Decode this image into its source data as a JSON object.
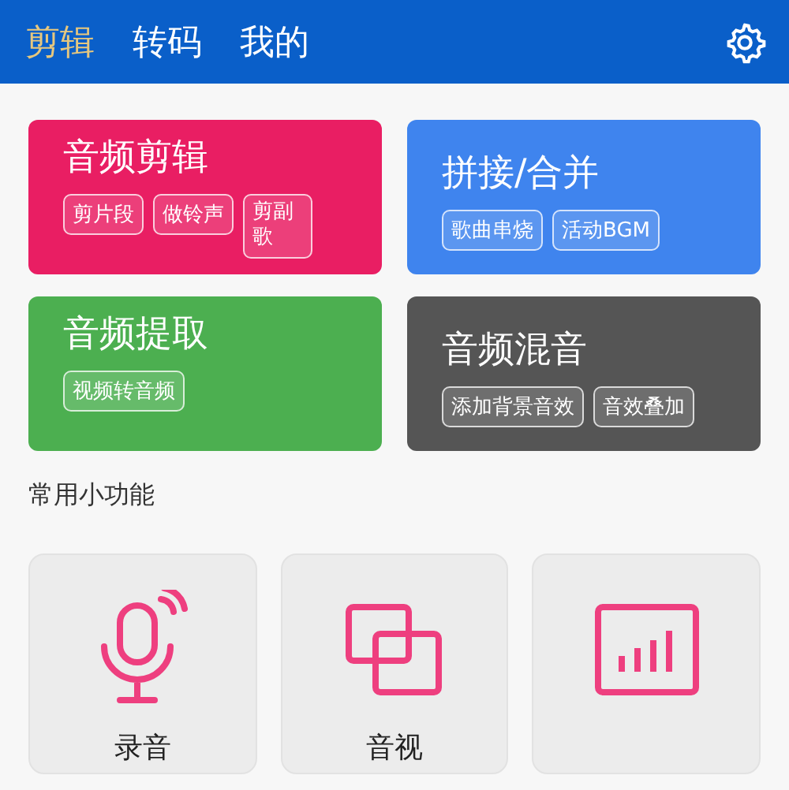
{
  "tabs": [
    {
      "label": "剪辑",
      "selected": true
    },
    {
      "label": "转码",
      "selected": false
    },
    {
      "label": "我的",
      "selected": false
    }
  ],
  "cards": [
    {
      "title": "音频剪辑",
      "color": "#e91e63",
      "chips": [
        "剪片段",
        "做铃声",
        "剪副歌"
      ]
    },
    {
      "title": "拼接/合并",
      "color": "#3f84ee",
      "chips": [
        "歌曲串烧",
        "活动BGM"
      ]
    },
    {
      "title": "音频提取",
      "color": "#4caf50",
      "chips": [
        "视频转音频"
      ]
    },
    {
      "title": "音频混音",
      "color": "#555555",
      "chips": [
        "添加背景音效",
        "音效叠加"
      ]
    }
  ],
  "section_title": "常用小功能",
  "tools": [
    {
      "kind": "microphone",
      "label": "录音"
    },
    {
      "kind": "overlap",
      "label": "音视"
    },
    {
      "kind": "chart"
    }
  ]
}
